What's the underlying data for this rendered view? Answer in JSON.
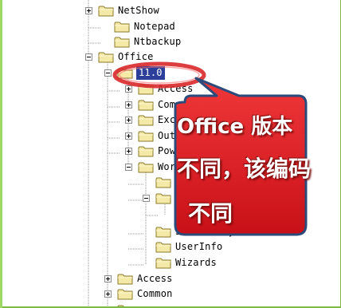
{
  "tree": {
    "items": [
      {
        "label": "NetShow",
        "x": 0,
        "y": 0,
        "exp": "plus"
      },
      {
        "label": "Notepad",
        "x": 0,
        "y": 0,
        "exp": "none"
      },
      {
        "label": "Ntbackup",
        "x": 0,
        "y": 0,
        "exp": "none"
      },
      {
        "label": "Office",
        "x": 0,
        "y": 0,
        "exp": "minus"
      },
      {
        "label": "11.0",
        "x": 0,
        "y": 0,
        "exp": "minus",
        "selected": true
      },
      {
        "label": "Access",
        "x": 0,
        "y": 0,
        "exp": "plus"
      },
      {
        "label": "Common",
        "x": 0,
        "y": 0,
        "exp": "plus"
      },
      {
        "label": "Excel",
        "x": 0,
        "y": 0,
        "exp": "plus"
      },
      {
        "label": "Outlook",
        "x": 0,
        "y": 0,
        "exp": "plus"
      },
      {
        "label": "PowerPoint",
        "x": 0,
        "y": 0,
        "exp": "plus"
      },
      {
        "label": "Word",
        "x": 0,
        "y": 0,
        "exp": "minus"
      },
      {
        "label": "",
        "x": 0,
        "y": 0,
        "exp": "none"
      },
      {
        "label": "",
        "x": 0,
        "y": 0,
        "exp": "minus"
      },
      {
        "label": "",
        "x": 0,
        "y": 0,
        "exp": "none"
      },
      {
        "label": "Stationery",
        "x": 0,
        "y": 0,
        "exp": "none"
      },
      {
        "label": "UserInfo",
        "x": 0,
        "y": 0,
        "exp": "none"
      },
      {
        "label": "Wizards",
        "x": 0,
        "y": 0,
        "exp": "none"
      },
      {
        "label": "Access",
        "x": 0,
        "y": 0,
        "exp": "plus"
      },
      {
        "label": "Common",
        "x": 0,
        "y": 0,
        "exp": "plus"
      },
      {
        "label": "",
        "x": 0,
        "y": 0,
        "exp": "plus"
      }
    ]
  },
  "callout": {
    "line1": "Office 版本",
    "line2": "不同，该编码",
    "line3": "不同"
  },
  "colors": {
    "folder_fill": "#f5e9a8",
    "folder_stroke": "#8a7a2a",
    "selection": "#2b3f9b",
    "callout_fill": "#e8202a",
    "callout_border": "#2c4a7a",
    "highlight_ring": "#d8282a",
    "background": "#9fd862"
  },
  "icons": {
    "folder": "folder-icon",
    "expand": "expand-plus-icon",
    "collapse": "collapse-minus-icon"
  }
}
